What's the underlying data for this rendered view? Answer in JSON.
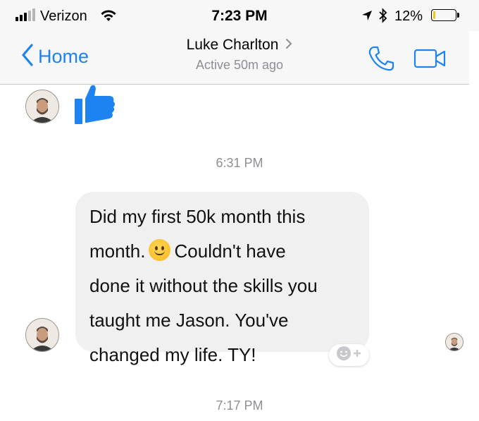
{
  "status_bar": {
    "carrier": "Verizon",
    "time": "7:23 PM",
    "battery_percent": "12%",
    "battery_level": 0.12,
    "icons": [
      "signal-icon",
      "wifi-icon",
      "location-arrow-icon",
      "bluetooth-icon",
      "battery-icon"
    ]
  },
  "nav": {
    "back_label": "Home",
    "contact_name": "Luke Charlton",
    "contact_status": "Active 50m ago",
    "icons": [
      "back-chevron-icon",
      "chevron-right-icon",
      "phone-icon",
      "video-camera-icon"
    ],
    "accent_color": "#1d83f0"
  },
  "messages": {
    "thumbs_up_icon": "thumbs-up-icon",
    "timestamp_1": "6:31 PM",
    "bubble": {
      "line_1": "Did my first 50k month this",
      "line_2_before_emoji": "month.",
      "emoji": "slightly-smiling-face",
      "line_2_after_emoji": "Couldn't have",
      "line_3": "done it without the skills you",
      "line_4": "taught me Jason. You've",
      "line_5": "changed my life. TY!"
    },
    "react_icon": "add-reaction-icon",
    "timestamp_2": "7:17 PM"
  }
}
